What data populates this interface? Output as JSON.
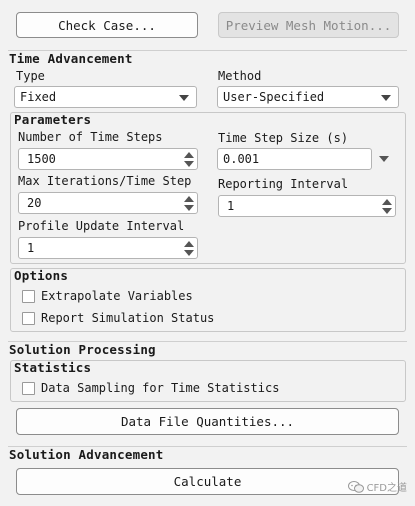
{
  "top_buttons": {
    "check_case": "Check Case...",
    "preview_mesh_motion": "Preview Mesh Motion..."
  },
  "time_advancement": {
    "title": "Time Advancement",
    "type_label": "Type",
    "type_value": "Fixed",
    "method_label": "Method",
    "method_value": "User-Specified"
  },
  "parameters": {
    "title": "Parameters",
    "num_steps_label": "Number of Time Steps",
    "num_steps_value": "1500",
    "step_size_label": "Time Step Size (s)",
    "step_size_value": "0.001",
    "max_iter_label": "Max Iterations/Time Step",
    "max_iter_value": "20",
    "reporting_label": "Reporting Interval",
    "reporting_value": "1",
    "profile_label": "Profile Update Interval",
    "profile_value": "1"
  },
  "options": {
    "title": "Options",
    "extrapolate": "Extrapolate Variables",
    "report_status": "Report Simulation Status"
  },
  "solution_processing": {
    "title": "Solution Processing",
    "statistics_title": "Statistics",
    "data_sampling": "Data Sampling for Time Statistics",
    "data_file_button": "Data File Quantities..."
  },
  "solution_advancement": {
    "title": "Solution Advancement",
    "calculate_button": "Calculate"
  },
  "watermark": {
    "text": "CFD之道",
    "icon": "wechat-icon"
  }
}
